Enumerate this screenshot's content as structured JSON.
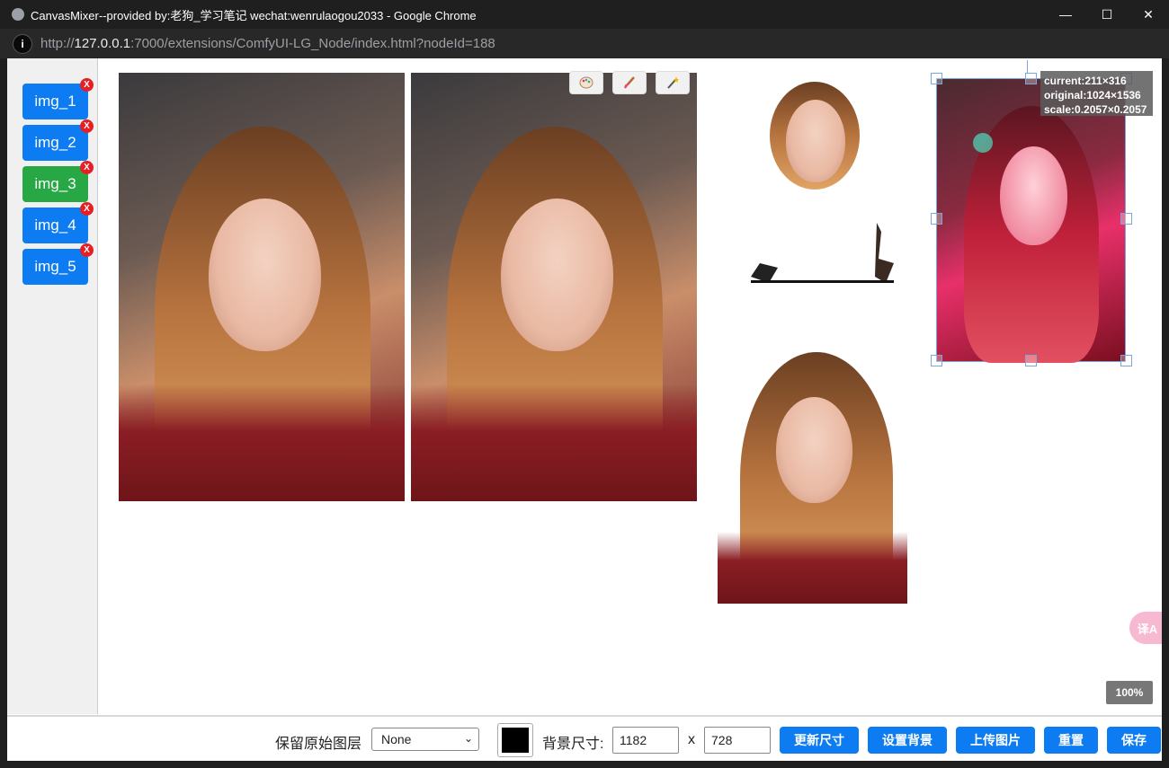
{
  "window": {
    "title": "CanvasMixer--provided by:老狗_学习笔记 wechat:wenrulaogou2033 - Google Chrome",
    "minimize": "—",
    "maximize": "☐",
    "close": "✕"
  },
  "address": {
    "info_icon": "i",
    "url_prefix": "http://",
    "url_host": "127.0.0.1",
    "url_rest": ":7000/extensions/ComfyUI-LG_Node/index.html?nodeId=188"
  },
  "sidebar": {
    "items": [
      {
        "label": "img_1",
        "delete": "X"
      },
      {
        "label": "img_2",
        "delete": "X"
      },
      {
        "label": "img_3",
        "delete": "X"
      },
      {
        "label": "img_4",
        "delete": "X"
      },
      {
        "label": "img_5",
        "delete": "X"
      }
    ],
    "active_index": 2
  },
  "canvas": {
    "tool_icons": [
      "palette-icon",
      "brush-icon",
      "magic-wand-icon"
    ],
    "info": {
      "current": "current:211×316",
      "original": "original:1024×1536",
      "scale": "scale:0.2057×0.2057"
    },
    "zoom": "100%",
    "translate_icon": "译A"
  },
  "bottom": {
    "keep_layer_label": "保留原始图层",
    "keep_layer_value": "None",
    "bg_color": "#000000",
    "bg_size_label": "背景尺寸:",
    "width": "1182",
    "x_label": "x",
    "height": "728",
    "buttons": {
      "update_size": "更新尺寸",
      "set_background": "设置背景",
      "upload_image": "上传图片",
      "reset": "重置",
      "save": "保存"
    }
  },
  "colors": {
    "primary": "#0d7cf2",
    "active": "#28a745",
    "delete": "#e51f24"
  }
}
